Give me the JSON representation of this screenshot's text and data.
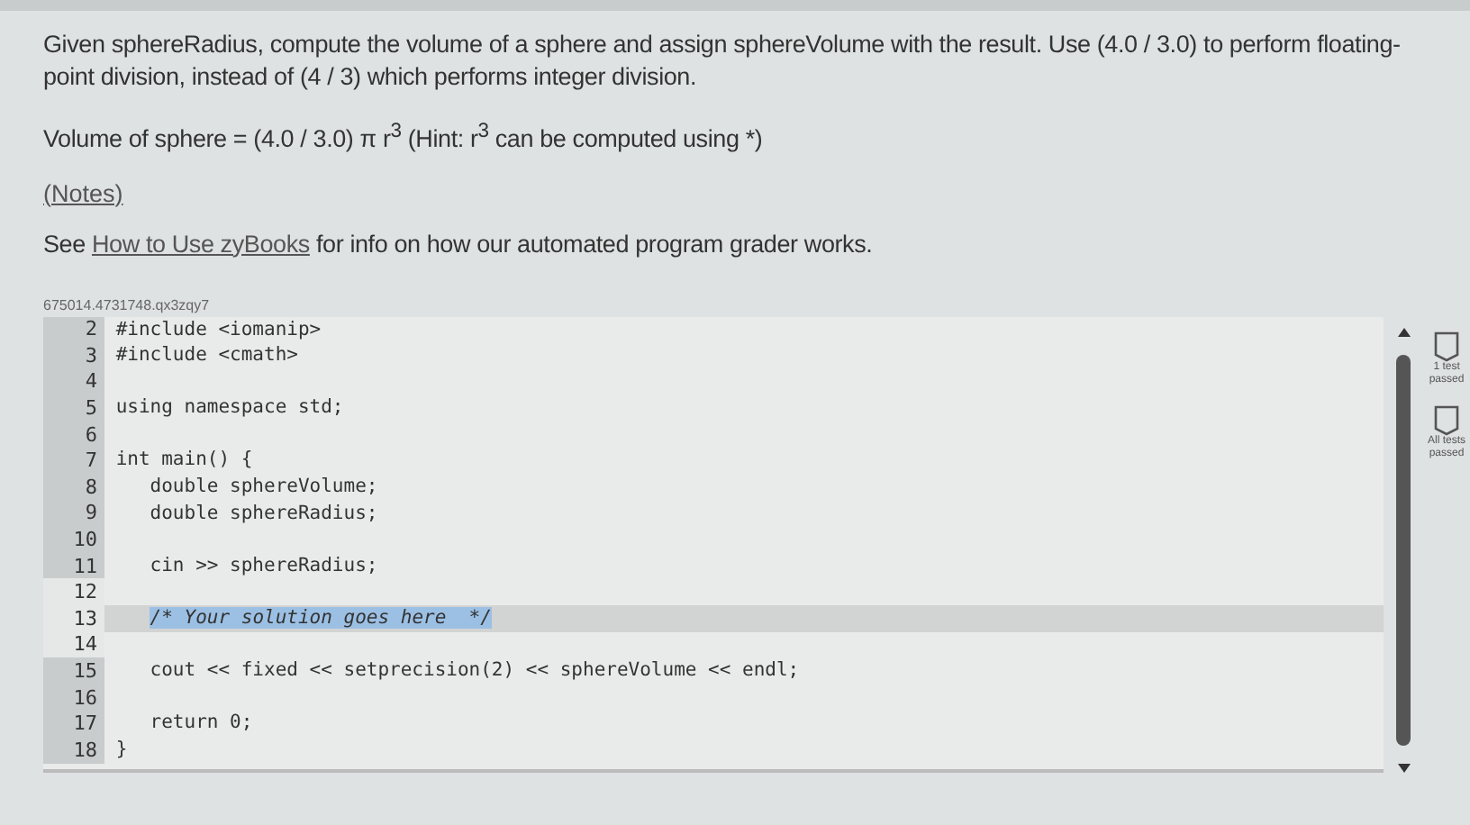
{
  "instructions": [
    "Given sphereRadius, compute the volume of a sphere and assign sphereVolume with the result. Use (4.0 / 3.0) to perform floating-point division, instead of (4 / 3) which performs integer division.",
    "Volume of sphere = (4.0 / 3.0) π r$^{3}$ (Hint: r$^{3}$ can be computed using *)"
  ],
  "notes_link": "(Notes)",
  "help": {
    "before": "See ",
    "link": "How to Use zyBooks",
    "after": " for info on how our automated program grader works."
  },
  "editor": {
    "file_id": "675014.4731748.qx3zqy7",
    "lines": [
      {
        "number": "2",
        "text": "#include <iomanip>",
        "selected": false
      },
      {
        "number": "3",
        "text": "#include <cmath>",
        "selected": false
      },
      {
        "number": "4",
        "selected": false
      },
      {
        "number": "5",
        "text": "using namespace std;",
        "selected": false
      },
      {
        "number": "6",
        "selected": false
      },
      {
        "number": "7",
        "text": "int main() {",
        "selected": false
      },
      {
        "number": "8",
        "text": "   double sphereVolume;",
        "selected": false
      },
      {
        "number": "9",
        "text": "   double sphereRadius;",
        "selected": false
      },
      {
        "number": "10",
        "selected": false
      },
      {
        "number": "11",
        "text": "   cin >> sphereRadius;",
        "selected": false
      },
      {
        "number": "12",
        "selected": false
      },
      {
        "number": "13",
        "text": "   /* Your solution goes here  */",
        "selected": true
      },
      {
        "number": "14",
        "selected": false
      },
      {
        "number": "15",
        "text": "   cout << fixed << setprecision(2) << sphereVolume << endl;",
        "selected": false
      },
      {
        "number": "16",
        "selected": false
      },
      {
        "number": "17",
        "text": "   return 0;",
        "selected": false
      },
      {
        "number": "18",
        "text": "}",
        "selected": false
      }
    ]
  },
  "tests": [
    {
      "label": "1 test passed",
      "passed": false
    },
    {
      "label": "All tests passed",
      "passed": false
    }
  ]
}
